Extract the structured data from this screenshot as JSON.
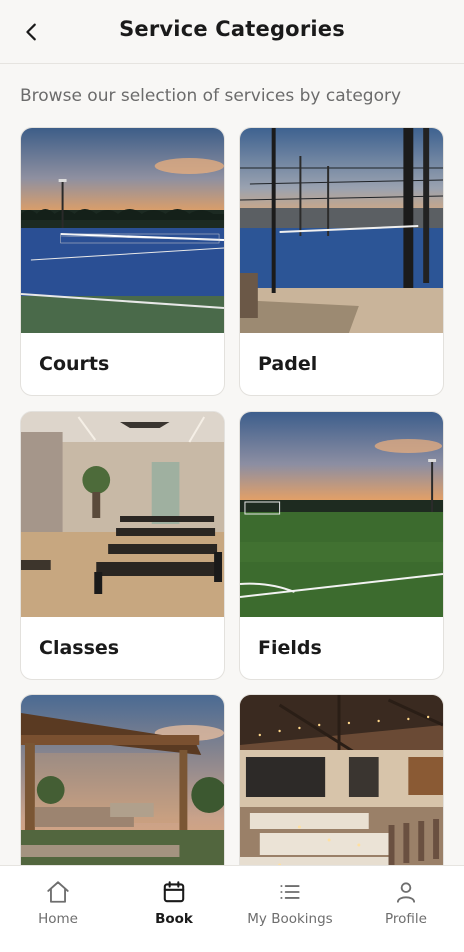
{
  "header": {
    "title": "Service Categories",
    "back_icon": "chevron-left-icon"
  },
  "subtitle": "Browse our selection of services by category",
  "categories": [
    {
      "label": "Courts"
    },
    {
      "label": "Padel"
    },
    {
      "label": "Classes"
    },
    {
      "label": "Fields"
    },
    {
      "label": ""
    },
    {
      "label": ""
    }
  ],
  "tabbar": {
    "active": "Book",
    "tabs": [
      {
        "label": "Home",
        "icon": "home-icon"
      },
      {
        "label": "Book",
        "icon": "calendar-icon"
      },
      {
        "label": "My Bookings",
        "icon": "list-icon"
      },
      {
        "label": "Profile",
        "icon": "user-icon"
      }
    ]
  },
  "colors": {
    "background": "#f8f7f5",
    "text": "#1a1a1a",
    "muted": "#6b6b6b"
  }
}
